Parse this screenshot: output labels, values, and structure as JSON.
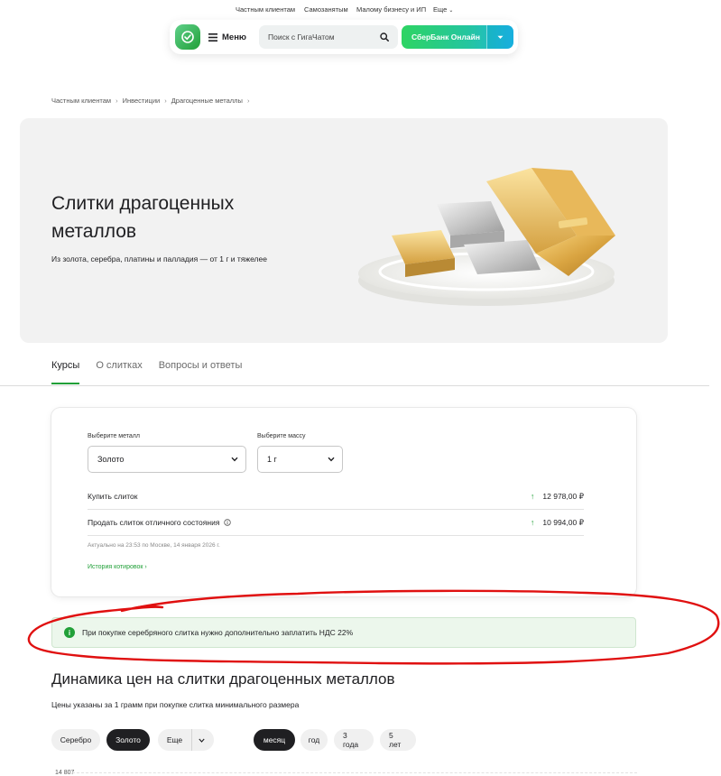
{
  "topnav": {
    "items": [
      "Частным клиентам",
      "Самозанятым",
      "Малому бизнесу и ИП",
      "Еще"
    ]
  },
  "header": {
    "menu_label": "Меню",
    "search_placeholder": "Поиск с ГигаЧатом",
    "online_label": "СберБанк Онлайн"
  },
  "breadcrumbs": [
    "Частным клиентам",
    "Инвестиции",
    "Драгоценные металлы"
  ],
  "hero": {
    "title": "Слитки драгоценных металлов",
    "subtitle": "Из золота, серебра, платины и палладия — от 1 г и тяжелее"
  },
  "tabs": [
    {
      "label": "Курсы",
      "active": true
    },
    {
      "label": "О слитках",
      "active": false
    },
    {
      "label": "Вопросы и ответы",
      "active": false
    }
  ],
  "calculator": {
    "metal_label": "Выберите металл",
    "metal_value": "Золото",
    "mass_label": "Выберите массу",
    "mass_value": "1 г",
    "buy_label": "Купить слиток",
    "buy_price": "12 978,00 ₽",
    "sell_label": "Продать слиток отличного состояния",
    "sell_price": "10 994,00 ₽",
    "updated_note": "Актуально на 23:53 по Москве, 14 января 2026 г.",
    "history_link": "История котировок ›"
  },
  "alert": {
    "text": "При покупке серебряного слитка нужно дополнительно заплатить НДС 22%"
  },
  "dynamics": {
    "title": "Динамика цен на слитки драгоценных металлов",
    "subtitle": "Цены указаны за 1 грамм при покупке слитка минимального размера",
    "metal_pills": [
      "Серебро",
      "Золото",
      "Еще"
    ],
    "period_pills": [
      "месяц",
      "год",
      "3 года",
      "5 лет"
    ],
    "first_axis_value": "14 807"
  },
  "colors": {
    "brand_green": "#21a038",
    "annotation_red": "#e01010"
  }
}
